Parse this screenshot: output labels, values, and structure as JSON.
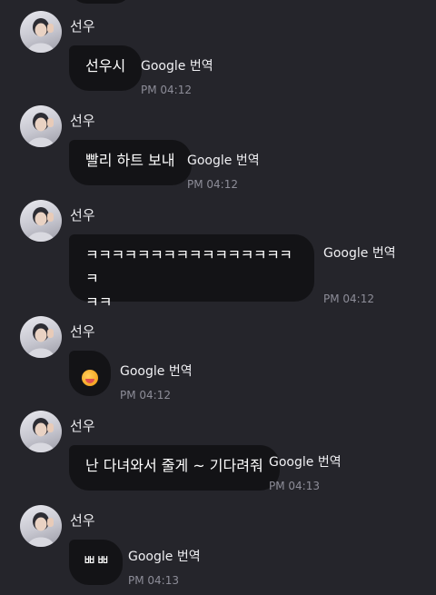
{
  "messages": [
    {
      "sender": "선우",
      "text": "선우시",
      "translate_label": "Google 번역",
      "time": "PM 04:12"
    },
    {
      "sender": "선우",
      "text": "빨리 하트 보내",
      "translate_label": "Google 번역",
      "time": "PM 04:12"
    },
    {
      "sender": "선우",
      "text_line1": "ㅋㅋㅋㅋㅋㅋㅋㅋㅋㅋㅋㅋㅋㅋㅋㅋㅋ",
      "text_line2": "ㅋㅋ",
      "translate_label": "Google 번역",
      "time": "PM 04:12"
    },
    {
      "sender": "선우",
      "emoji": "face-emoji",
      "translate_label": "Google 번역",
      "time": "PM 04:12"
    },
    {
      "sender": "선우",
      "text": "난 다녀와서 줄게 ~ 기다려줘",
      "translate_label": "Google 번역",
      "time": "PM 04:13"
    },
    {
      "sender": "선우",
      "text": "ㅃㅃ",
      "translate_label": "Google 번역",
      "time": "PM 04:13"
    }
  ],
  "colors": {
    "background": "#25252b",
    "bubble": "#131316",
    "time": "#8d8d98"
  }
}
